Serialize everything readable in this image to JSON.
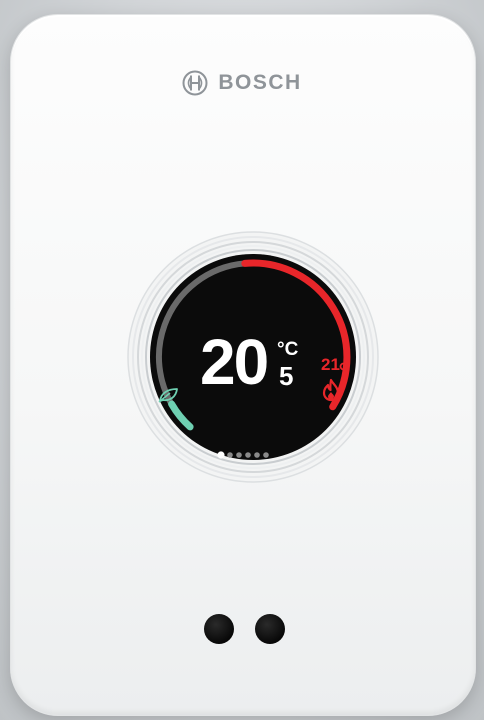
{
  "brand": {
    "name": "BOSCH",
    "logo_icon": "bosch-armature-icon"
  },
  "display": {
    "current_temp_whole": "20",
    "current_temp_decimal": "5",
    "unit": "°C",
    "setpoint": "21",
    "heating_icon": "flame-icon",
    "eco_icon": "leaf-icon",
    "page_indicator": {
      "count": 6,
      "active_index": 0
    }
  },
  "colors": {
    "heating": "#e8262a",
    "eco": "#6fd0b2",
    "ring_track": "#6a6a6a",
    "screen": "#0b0b0b",
    "device": "#f7f8f8"
  }
}
